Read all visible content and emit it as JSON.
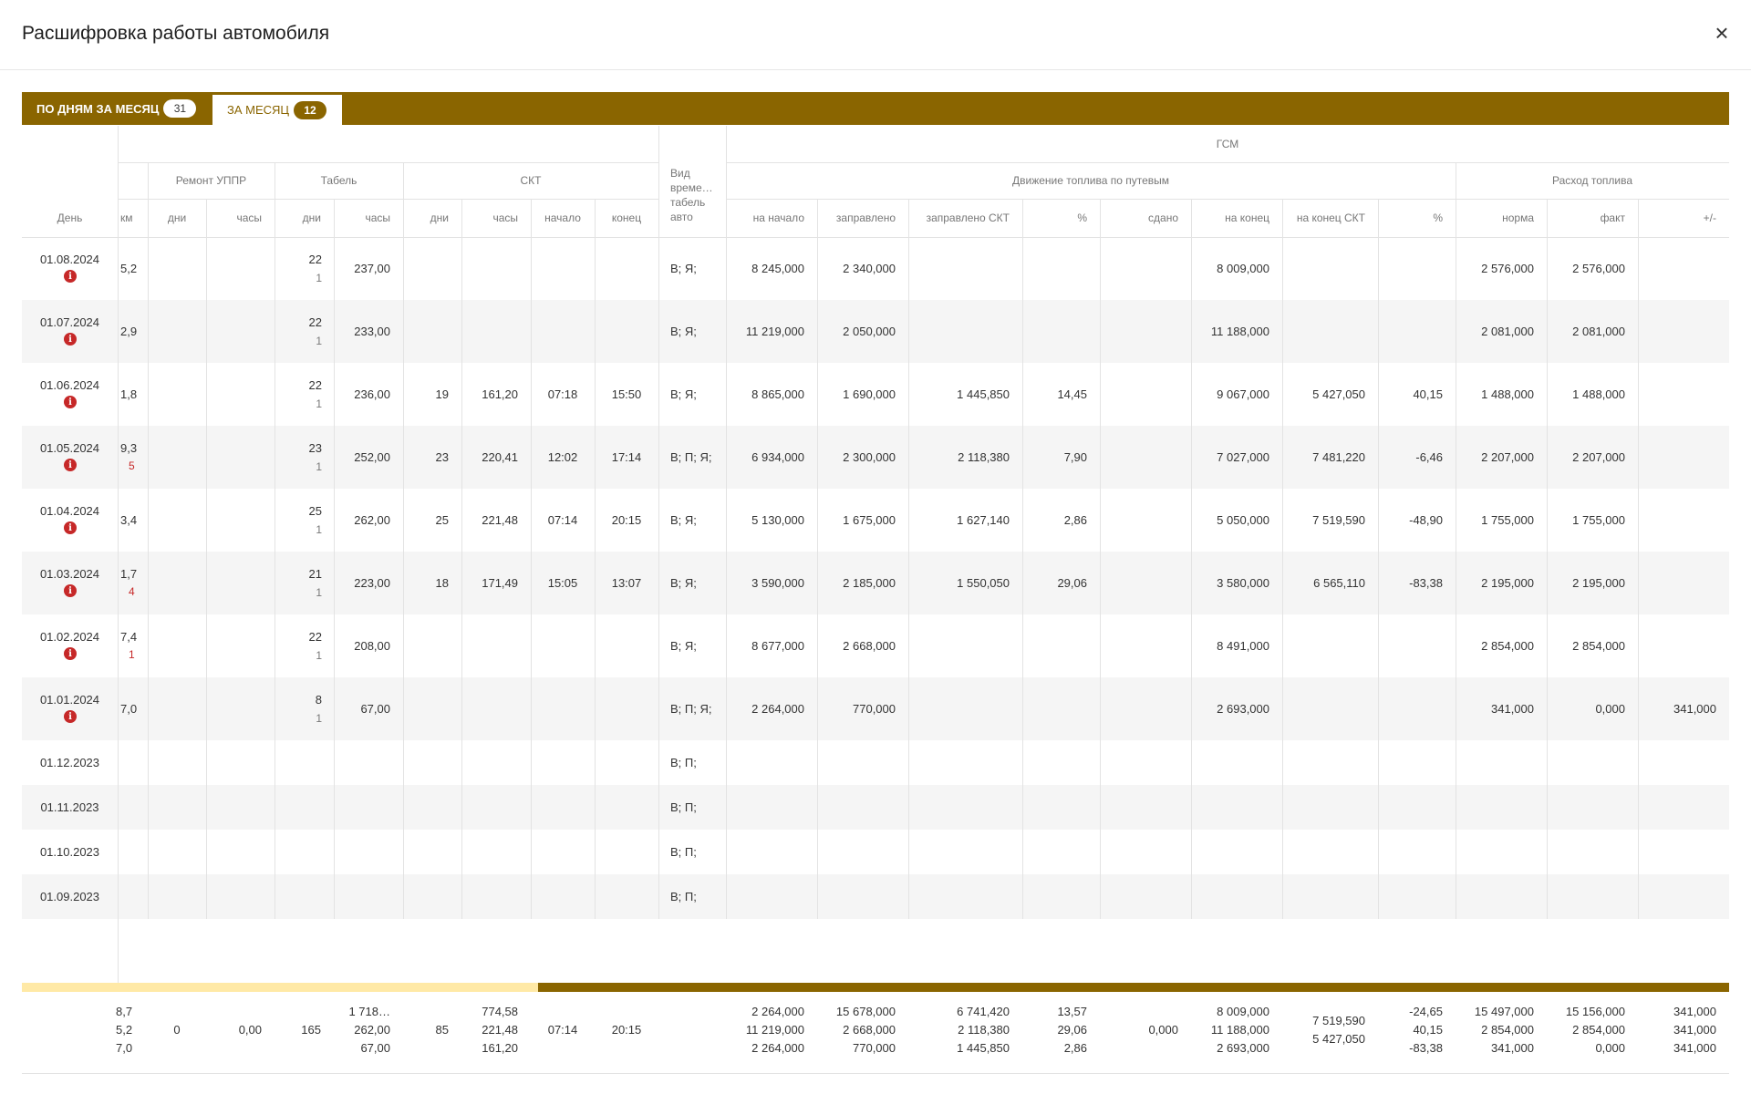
{
  "dialog": {
    "title": "Расшифровка работы автомобиля",
    "close_icon": "×"
  },
  "tabs": [
    {
      "label": "ПО ДНЯМ ЗА МЕСЯЦ",
      "count": "31"
    },
    {
      "label": "ЗА МЕСЯЦ",
      "count": "12"
    }
  ],
  "headers": {
    "day": "День",
    "km": "км",
    "repair_group": "Ремонт УППР",
    "repair_days": "дни",
    "repair_hours": "часы",
    "tabel_group": "Табель",
    "tabel_days": "дни",
    "tabel_hours": "часы",
    "skt_group": "СКТ",
    "skt_days": "дни",
    "skt_hours": "часы",
    "skt_start": "начало",
    "skt_end": "конец",
    "vid_line1": "Вид",
    "vid_line2": "време…",
    "vid_line3": "табель",
    "vid_line4": "авто",
    "gsm_group": "ГСМ",
    "movement_group": "Движение топлива по путевым",
    "consumption_group": "Расход топлива",
    "f_start": "на начало",
    "f_refuel": "заправлено",
    "f_refuel_skt": "заправлено СКТ",
    "f_pct": "%",
    "f_handed": "сдано",
    "f_end": "на конец",
    "f_end_skt": "на конец СКТ",
    "f_pct2": "%",
    "c_norm": "норма",
    "c_fact": "факт",
    "c_diff": "+/-"
  },
  "rows": [
    {
      "day": "01.08.2024",
      "info": true,
      "km": "5,2",
      "km2": "",
      "tabel_days": "22",
      "tabel_days2": "1",
      "tabel_hours": "237,00",
      "skt_days": "",
      "skt_hours": "",
      "skt_start": "",
      "skt_end": "",
      "vid": "В; Я;",
      "f_start": "8 245,000",
      "f_refuel": "2 340,000",
      "f_refuel_skt": "",
      "f_pct": "",
      "f_handed": "",
      "f_end": "8 009,000",
      "f_end_skt": "",
      "f_pct2": "",
      "c_norm": "2 576,000",
      "c_fact": "2 576,000",
      "c_diff": ""
    },
    {
      "day": "01.07.2024",
      "info": true,
      "km": "2,9",
      "km2": "",
      "tabel_days": "22",
      "tabel_days2": "1",
      "tabel_hours": "233,00",
      "skt_days": "",
      "skt_hours": "",
      "skt_start": "",
      "skt_end": "",
      "vid": "В; Я;",
      "f_start": "11 219,000",
      "f_refuel": "2 050,000",
      "f_refuel_skt": "",
      "f_pct": "",
      "f_handed": "",
      "f_end": "11 188,000",
      "f_end_skt": "",
      "f_pct2": "",
      "c_norm": "2 081,000",
      "c_fact": "2 081,000",
      "c_diff": ""
    },
    {
      "day": "01.06.2024",
      "info": true,
      "km": "1,8",
      "km2": "",
      "tabel_days": "22",
      "tabel_days2": "1",
      "tabel_hours": "236,00",
      "skt_days": "19",
      "skt_hours": "161,20",
      "skt_start": "07:18",
      "skt_end": "15:50",
      "vid": "В; Я;",
      "f_start": "8 865,000",
      "f_refuel": "1 690,000",
      "f_refuel_skt": "1 445,850",
      "f_pct": "14,45",
      "f_handed": "",
      "f_end": "9 067,000",
      "f_end_skt": "5 427,050",
      "f_pct2": "40,15",
      "c_norm": "1 488,000",
      "c_fact": "1 488,000",
      "c_diff": ""
    },
    {
      "day": "01.05.2024",
      "info": true,
      "km": "9,3",
      "km2": "5",
      "tabel_days": "23",
      "tabel_days2": "1",
      "tabel_hours": "252,00",
      "skt_days": "23",
      "skt_hours": "220,41",
      "skt_start": "12:02",
      "skt_end": "17:14",
      "vid": "В; П; Я;",
      "f_start": "6 934,000",
      "f_refuel": "2 300,000",
      "f_refuel_skt": "2 118,380",
      "f_pct": "7,90",
      "f_handed": "",
      "f_end": "7 027,000",
      "f_end_skt": "7 481,220",
      "f_pct2": "-6,46",
      "c_norm": "2 207,000",
      "c_fact": "2 207,000",
      "c_diff": ""
    },
    {
      "day": "01.04.2024",
      "info": true,
      "km": "3,4",
      "km2": "",
      "tabel_days": "25",
      "tabel_days2": "1",
      "tabel_hours": "262,00",
      "skt_days": "25",
      "skt_hours": "221,48",
      "skt_start": "07:14",
      "skt_end": "20:15",
      "vid": "В; Я;",
      "f_start": "5 130,000",
      "f_refuel": "1 675,000",
      "f_refuel_skt": "1 627,140",
      "f_pct": "2,86",
      "f_handed": "",
      "f_end": "5 050,000",
      "f_end_skt": "7 519,590",
      "f_pct2": "-48,90",
      "c_norm": "1 755,000",
      "c_fact": "1 755,000",
      "c_diff": ""
    },
    {
      "day": "01.03.2024",
      "info": true,
      "km": "1,7",
      "km2": "4",
      "tabel_days": "21",
      "tabel_days2": "1",
      "tabel_hours": "223,00",
      "skt_days": "18",
      "skt_hours": "171,49",
      "skt_start": "15:05",
      "skt_end": "13:07",
      "vid": "В; Я;",
      "f_start": "3 590,000",
      "f_refuel": "2 185,000",
      "f_refuel_skt": "1 550,050",
      "f_pct": "29,06",
      "f_handed": "",
      "f_end": "3 580,000",
      "f_end_skt": "6 565,110",
      "f_pct2": "-83,38",
      "c_norm": "2 195,000",
      "c_fact": "2 195,000",
      "c_diff": ""
    },
    {
      "day": "01.02.2024",
      "info": true,
      "km": "7,4",
      "km2": "1",
      "tabel_days": "22",
      "tabel_days2": "1",
      "tabel_hours": "208,00",
      "skt_days": "",
      "skt_hours": "",
      "skt_start": "",
      "skt_end": "",
      "vid": "В; Я;",
      "f_start": "8 677,000",
      "f_refuel": "2 668,000",
      "f_refuel_skt": "",
      "f_pct": "",
      "f_handed": "",
      "f_end": "8 491,000",
      "f_end_skt": "",
      "f_pct2": "",
      "c_norm": "2 854,000",
      "c_fact": "2 854,000",
      "c_diff": ""
    },
    {
      "day": "01.01.2024",
      "info": true,
      "km": "7,0",
      "km2": "",
      "tabel_days": "8",
      "tabel_days2": "1",
      "tabel_hours": "67,00",
      "skt_days": "",
      "skt_hours": "",
      "skt_start": "",
      "skt_end": "",
      "vid": "В; П; Я;",
      "f_start": "2 264,000",
      "f_refuel": "770,000",
      "f_refuel_skt": "",
      "f_pct": "",
      "f_handed": "",
      "f_end": "2 693,000",
      "f_end_skt": "",
      "f_pct2": "",
      "c_norm": "341,000",
      "c_fact": "0,000",
      "c_diff": "341,000"
    },
    {
      "day": "01.12.2023",
      "info": false,
      "km": "",
      "km2": "",
      "tabel_days": "",
      "tabel_days2": "",
      "tabel_hours": "",
      "skt_days": "",
      "skt_hours": "",
      "skt_start": "",
      "skt_end": "",
      "vid": "В; П;",
      "f_start": "",
      "f_refuel": "",
      "f_refuel_skt": "",
      "f_pct": "",
      "f_handed": "",
      "f_end": "",
      "f_end_skt": "",
      "f_pct2": "",
      "c_norm": "",
      "c_fact": "",
      "c_diff": ""
    },
    {
      "day": "01.11.2023",
      "info": false,
      "km": "",
      "km2": "",
      "tabel_days": "",
      "tabel_days2": "",
      "tabel_hours": "",
      "skt_days": "",
      "skt_hours": "",
      "skt_start": "",
      "skt_end": "",
      "vid": "В; П;",
      "f_start": "",
      "f_refuel": "",
      "f_refuel_skt": "",
      "f_pct": "",
      "f_handed": "",
      "f_end": "",
      "f_end_skt": "",
      "f_pct2": "",
      "c_norm": "",
      "c_fact": "",
      "c_diff": ""
    },
    {
      "day": "01.10.2023",
      "info": false,
      "km": "",
      "km2": "",
      "tabel_days": "",
      "tabel_days2": "",
      "tabel_hours": "",
      "skt_days": "",
      "skt_hours": "",
      "skt_start": "",
      "skt_end": "",
      "vid": "В; П;",
      "f_start": "",
      "f_refuel": "",
      "f_refuel_skt": "",
      "f_pct": "",
      "f_handed": "",
      "f_end": "",
      "f_end_skt": "",
      "f_pct2": "",
      "c_norm": "",
      "c_fact": "",
      "c_diff": ""
    },
    {
      "day": "01.09.2023",
      "info": false,
      "km": "",
      "km2": "",
      "tabel_days": "",
      "tabel_days2": "",
      "tabel_hours": "",
      "skt_days": "",
      "skt_hours": "",
      "skt_start": "",
      "skt_end": "",
      "vid": "В; П;",
      "f_start": "",
      "f_refuel": "",
      "f_refuel_skt": "",
      "f_pct": "",
      "f_handed": "",
      "f_end": "",
      "f_end_skt": "",
      "f_pct2": "",
      "c_norm": "",
      "c_fact": "",
      "c_diff": ""
    }
  ],
  "info_icon": "i",
  "totals": {
    "km": [
      "8,7",
      "5,2",
      "7,0"
    ],
    "repair_days": [
      "0"
    ],
    "repair_hours": [
      "0,00"
    ],
    "tabel_days": [
      "165"
    ],
    "tabel_hours": [
      "1 718…",
      "262,00",
      "67,00"
    ],
    "skt_days": [
      "85"
    ],
    "skt_hours": [
      "774,58",
      "221,48",
      "161,20"
    ],
    "skt_start": [
      "07:14"
    ],
    "skt_end": [
      "20:15"
    ],
    "f_start": [
      "2 264,000",
      "11 219,000",
      "2 264,000"
    ],
    "f_refuel": [
      "15 678,000",
      "2 668,000",
      "770,000"
    ],
    "f_refuel_skt": [
      "6 741,420",
      "2 118,380",
      "1 445,850"
    ],
    "f_pct": [
      "13,57",
      "29,06",
      "2,86"
    ],
    "f_handed": [
      "0,000"
    ],
    "f_end": [
      "8 009,000",
      "11 188,000",
      "2 693,000"
    ],
    "f_end_skt": [
      "7 519,590",
      "5 427,050"
    ],
    "f_pct2": [
      "-24,65",
      "40,15",
      "-83,38"
    ],
    "c_norm": [
      "15 497,000",
      "2 854,000",
      "341,000"
    ],
    "c_fact": [
      "15 156,000",
      "2 854,000",
      "0,000"
    ],
    "c_diff": [
      "341,000",
      "341,000",
      "341,000"
    ]
  }
}
